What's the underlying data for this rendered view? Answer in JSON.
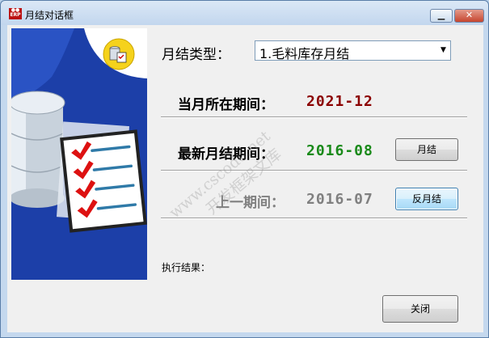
{
  "window": {
    "title": "月结对话框",
    "app_icon": "erp-icon"
  },
  "titlebar_buttons": {
    "minimize": "minimize-icon",
    "close": "close-icon"
  },
  "form": {
    "type_label": "月结类型：",
    "type_value": "1.毛料库存月结",
    "current_period_label": "当月所在期间：",
    "current_period_value": "2021-12",
    "latest_period_label": "最新月结期间：",
    "latest_period_value": "2016-08",
    "previous_period_label": "上一期间：",
    "previous_period_value": "2016-07",
    "result_label": "执行结果："
  },
  "buttons": {
    "month_close": "月结",
    "reverse_month_close": "反月结",
    "close": "关闭"
  },
  "watermark": {
    "line1": "www.cscode.net",
    "line2": "开发框架文库"
  },
  "colors": {
    "current_period": "#8b0000",
    "latest_period": "#1a8a1a",
    "previous_period": "#808080",
    "panel_blue": "#1c3fa8"
  },
  "icons": [
    "database-icon",
    "checklist-icon",
    "calendar-db-badge-icon",
    "dropdown-arrow-icon"
  ]
}
